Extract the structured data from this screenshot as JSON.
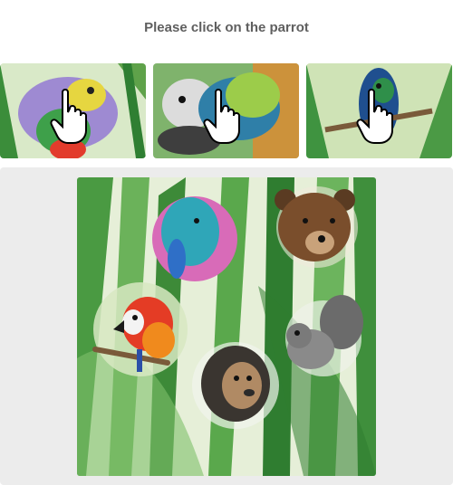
{
  "prompt": {
    "text": "Please click on the parrot"
  },
  "examples": [
    {
      "subject": "parrot",
      "style": "watercolor",
      "accent": "#7a5cc7"
    },
    {
      "subject": "parrot",
      "style": "watercolor",
      "accent": "#e07a22"
    },
    {
      "subject": "parrot",
      "style": "watercolor",
      "accent": "#2f8f3a"
    }
  ],
  "challenge": {
    "background": "jungle-leaves-watercolor",
    "items": [
      {
        "subject": "elephant",
        "icon": "elephant-icon"
      },
      {
        "subject": "bear",
        "icon": "bear-icon"
      },
      {
        "subject": "parrot",
        "icon": "parrot-icon"
      },
      {
        "subject": "squirrel",
        "icon": "squirrel-icon"
      },
      {
        "subject": "lion",
        "icon": "lion-icon"
      }
    ]
  },
  "colors": {
    "prompt_text": "#5f5f5f",
    "panel_bg": "#ececec",
    "leaf_green": "#3f8f3c"
  }
}
